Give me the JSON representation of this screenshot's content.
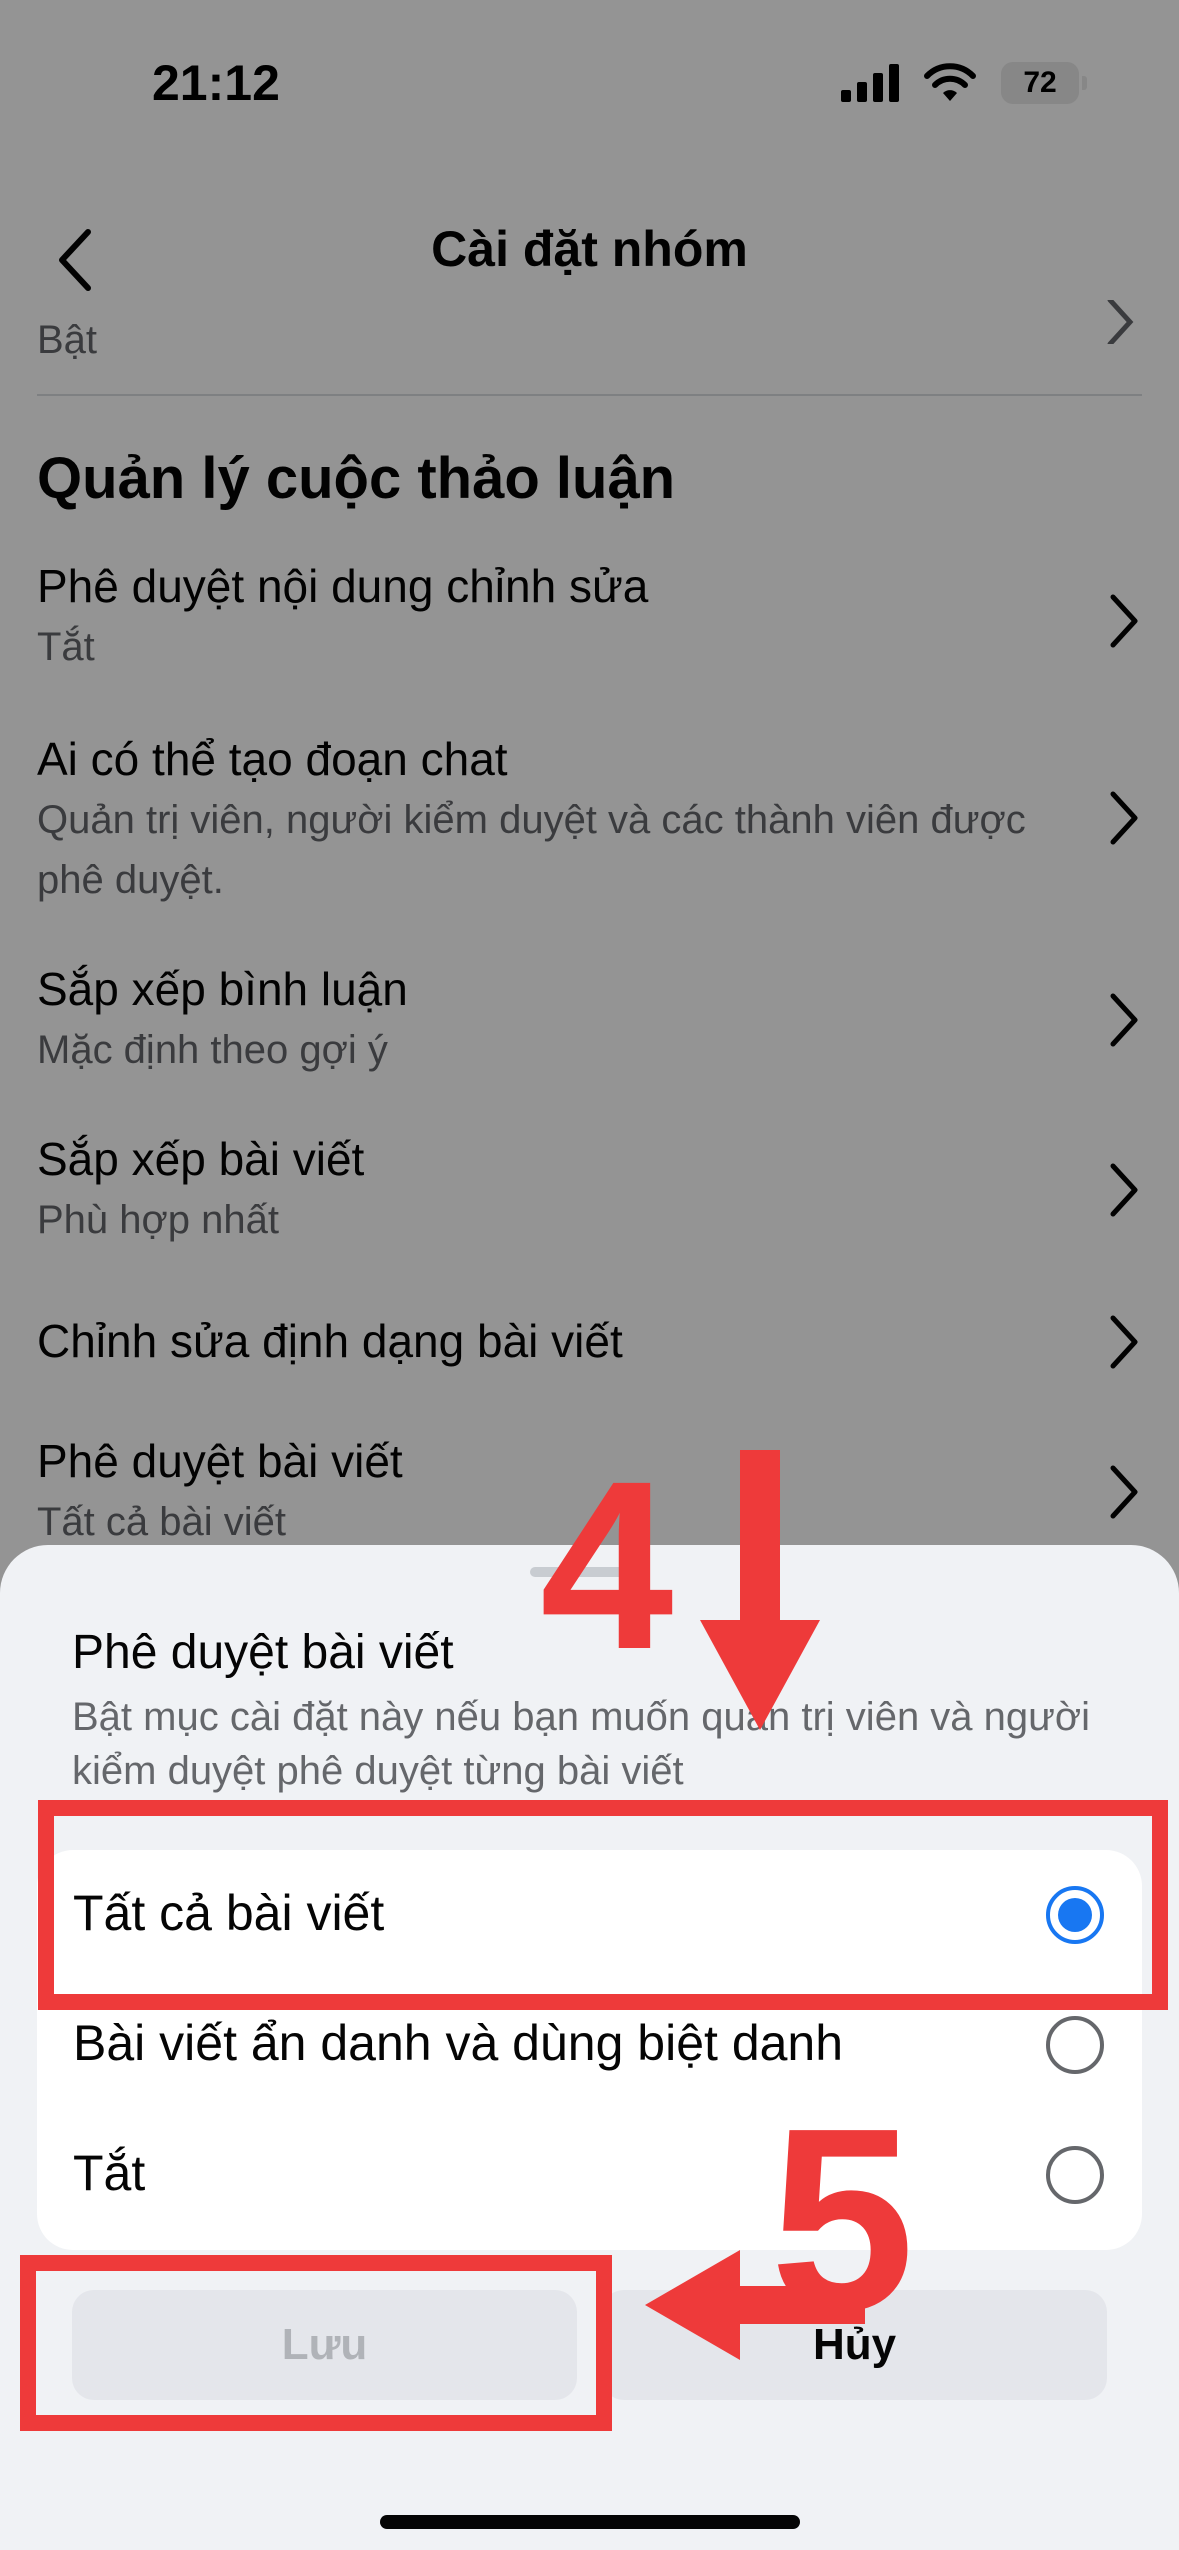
{
  "status_bar": {
    "time": "21:12",
    "battery": "72",
    "icons": [
      "signal-icon",
      "wifi-icon",
      "battery-icon"
    ]
  },
  "nav": {
    "title": "Cài đặt nhóm",
    "back_icon": "chevron-left-icon"
  },
  "partial_row": {
    "subtitle": "Bật"
  },
  "section": {
    "title": "Quản lý cuộc thảo luận",
    "rows": [
      {
        "title": "Phê duyệt nội dung chỉnh sửa",
        "subtitle": "Tắt"
      },
      {
        "title": "Ai có thể tạo đoạn chat",
        "subtitle": "Quản trị viên, người kiểm duyệt và các thành viên được phê duyệt."
      },
      {
        "title": "Sắp xếp bình luận",
        "subtitle": "Mặc định theo gợi ý"
      },
      {
        "title": "Sắp xếp bài viết",
        "subtitle": "Phù hợp nhất"
      },
      {
        "title": "Chỉnh sửa định dạng bài viết",
        "subtitle": ""
      },
      {
        "title": "Phê duyệt bài viết",
        "subtitle": "Tất cả bài viết"
      }
    ]
  },
  "sheet": {
    "title": "Phê duyệt bài viết",
    "description": "Bật mục cài đặt này nếu bạn muốn quản trị viên và người kiểm duyệt phê duyệt từng bài viết",
    "options": [
      {
        "label": "Tất cả bài viết",
        "selected": true
      },
      {
        "label": "Bài viết ẩn danh và dùng biệt danh",
        "selected": false
      },
      {
        "label": "Tắt",
        "selected": false
      }
    ],
    "save_label": "Lưu",
    "cancel_label": "Hủy"
  },
  "annotations": {
    "step_4": "4",
    "step_5": "5",
    "color": "#ee3a3a"
  },
  "colors": {
    "accent": "#1877f2",
    "secondary_text": "#65676b",
    "annotation": "#ee3a3a"
  }
}
